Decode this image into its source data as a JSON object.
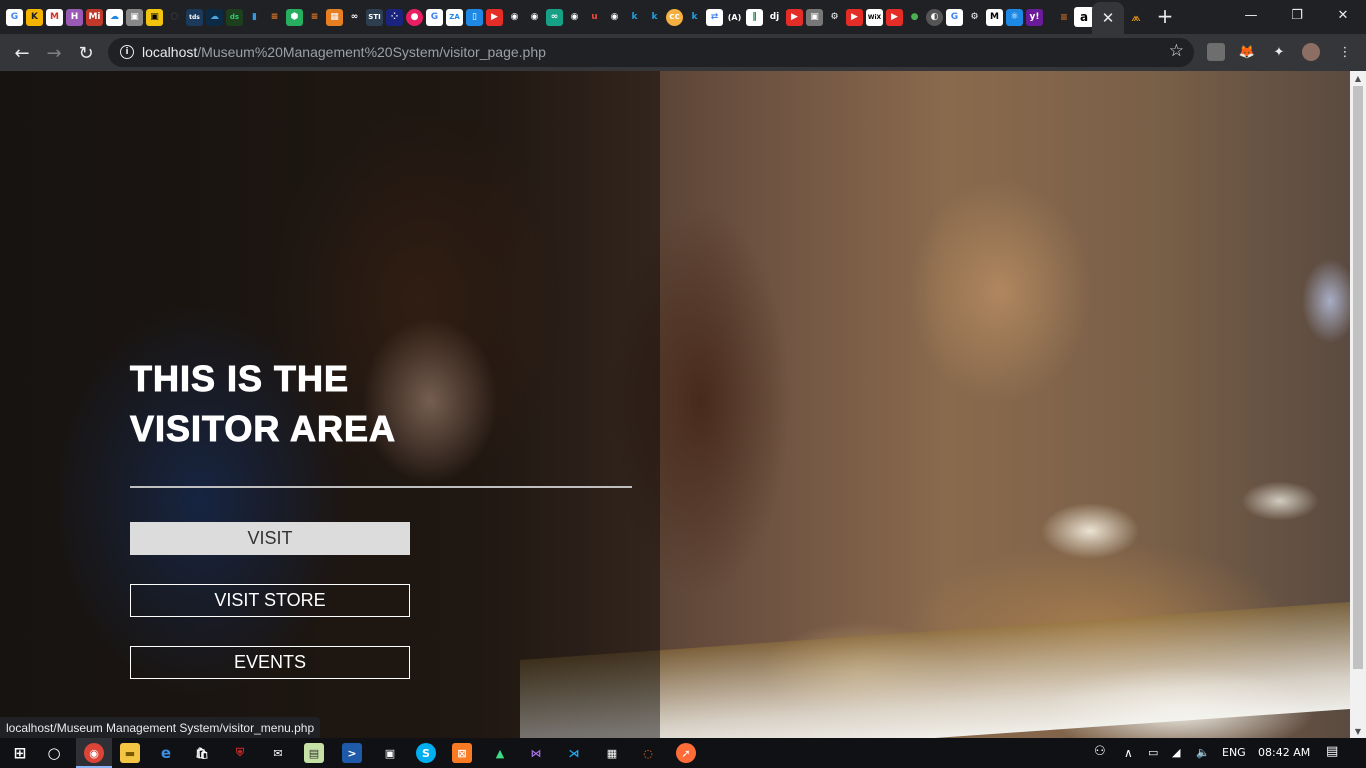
{
  "browser": {
    "address": {
      "host": "localhost",
      "path": "/Museum%20Management%20System/visitor_page.php"
    },
    "bookmark_icons": [
      "google-icon",
      "k-icon",
      "gmail-icon",
      "h-icon",
      "mi-icon",
      "cloud-icon",
      "doc-icon",
      "yellow-app-icon",
      "github-icon",
      "tds-icon",
      "cloud2-icon",
      "ds-icon",
      "bar-chart-icon",
      "stack-icon",
      "stack2-icon",
      "grid-icon",
      "infinity-icon",
      "str-icon",
      "dots-icon",
      "record-icon",
      "google2-icon",
      "za-icon",
      "phone-icon",
      "youtube-icon",
      "github2-icon",
      "github3-icon",
      "codesandbox-icon",
      "github4-icon",
      "u-icon",
      "github5-icon",
      "k2-icon",
      "k3-icon",
      "cc-icon",
      "k4-icon",
      "translate-icon",
      "mathjax-icon",
      "hi-icon",
      "django-icon",
      "youtube2-icon",
      "docker-icon",
      "python-icon",
      "youtube3-icon",
      "wix-icon",
      "youtube4-icon",
      "mongo-icon",
      "globe-icon",
      "google3-icon",
      "python2-icon",
      "medium-icon",
      "react-icon",
      "yahoo-icon",
      "stack3-icon",
      "amazon-icon"
    ],
    "active_tab_close": "✕",
    "new_tab": "+",
    "window_controls": {
      "minimize": "—",
      "restore": "❐",
      "close": "✕"
    }
  },
  "page": {
    "heading_line1": "THIS IS THE",
    "heading_line2": "VISITOR AREA",
    "menu": [
      {
        "label": "VISIT",
        "hovered": true
      },
      {
        "label": "VISIT STORE",
        "hovered": false
      },
      {
        "label": "EVENTS",
        "hovered": false
      }
    ],
    "status_url": "localhost/Museum Management System/visitor_menu.php"
  },
  "taskbar": {
    "language": "ENG",
    "time": "08:42 AM"
  },
  "colors": {
    "chrome_dark": "#202124",
    "toolbar": "#35363a",
    "button_hover_bg": "#dcdcdc",
    "text_white": "#ffffff"
  }
}
